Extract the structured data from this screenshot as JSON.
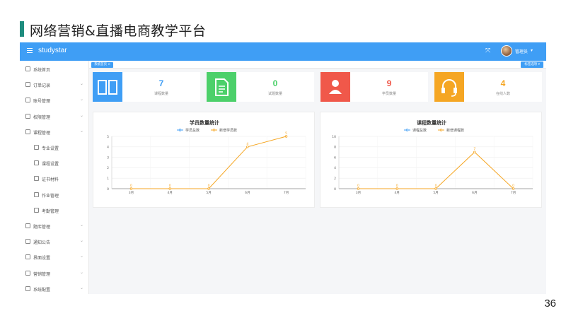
{
  "slide": {
    "title": "网络营销&直播电商教学平台",
    "page_number": "36"
  },
  "colors": {
    "topbar": "#3f9ef5",
    "accent": "#1e8c7e",
    "series_total": "#3f9ef5",
    "series_new": "#f5a623"
  },
  "topbar": {
    "brand": "studystar",
    "fullscreen_icon": "expand-icon",
    "user_name": "管理员",
    "caret": "▾"
  },
  "sidebar": {
    "items": [
      {
        "label": "系统首页",
        "icon": "home-icon",
        "expandable": false,
        "sub": false
      },
      {
        "label": "订单记录",
        "icon": "order-icon",
        "expandable": true,
        "sub": false
      },
      {
        "label": "账号管理",
        "icon": "user-icon",
        "expandable": true,
        "sub": false
      },
      {
        "label": "权限管理",
        "icon": "key-icon",
        "expandable": true,
        "sub": false
      },
      {
        "label": "课程管理",
        "icon": "course-icon",
        "expandable": true,
        "sub": false
      },
      {
        "label": "专业设置",
        "icon": "major-icon",
        "expandable": false,
        "sub": true
      },
      {
        "label": "课程设置",
        "icon": "lesson-icon",
        "expandable": false,
        "sub": true
      },
      {
        "label": "证书材料",
        "icon": "trophy-icon",
        "expandable": false,
        "sub": true
      },
      {
        "label": "作业管理",
        "icon": "homework-icon",
        "expandable": false,
        "sub": true
      },
      {
        "label": "考勤管理",
        "icon": "clock-icon",
        "expandable": false,
        "sub": true
      },
      {
        "label": "题库管理",
        "icon": "bank-icon",
        "expandable": true,
        "sub": false
      },
      {
        "label": "通知公告",
        "icon": "notice-icon",
        "expandable": true,
        "sub": false
      },
      {
        "label": "界面设置",
        "icon": "screen-icon",
        "expandable": true,
        "sub": false
      },
      {
        "label": "营销管理",
        "icon": "marketing-icon",
        "expandable": true,
        "sub": false
      },
      {
        "label": "系统配置",
        "icon": "grid-icon",
        "expandable": true,
        "sub": false
      }
    ]
  },
  "tabs": {
    "active": "系统首页 ×",
    "ops": "标签选项 ▾"
  },
  "stats": [
    {
      "value": "7",
      "label": "课程数量",
      "color": "#3f9ef5",
      "icon": "book-icon"
    },
    {
      "value": "0",
      "label": "试题数量",
      "color": "#4cd06a",
      "icon": "document-icon"
    },
    {
      "value": "9",
      "label": "学员数量",
      "color": "#f0584a",
      "icon": "person-icon"
    },
    {
      "value": "4",
      "label": "在线人数",
      "color": "#f5a623",
      "icon": "headset-icon"
    }
  ],
  "chart_data": [
    {
      "type": "line",
      "title": "学员数量统计",
      "categories": [
        "3月",
        "4月",
        "5月",
        "6月",
        "7月"
      ],
      "ylim": [
        0,
        5
      ],
      "yticks": [
        0,
        1,
        2,
        3,
        4,
        5
      ],
      "grid": true,
      "legend": "top-center",
      "series": [
        {
          "name": "学员总数",
          "values": [
            0,
            0,
            0,
            4,
            5
          ],
          "visible": false
        },
        {
          "name": "新增学员数",
          "values": [
            0,
            0,
            0,
            4,
            5
          ],
          "visible": true
        }
      ]
    },
    {
      "type": "line",
      "title": "课程数量统计",
      "categories": [
        "3月",
        "4月",
        "5月",
        "6月",
        "7月"
      ],
      "ylim": [
        0,
        10
      ],
      "yticks": [
        0,
        2,
        4,
        6,
        8,
        10
      ],
      "grid": true,
      "legend": "top-center",
      "series": [
        {
          "name": "课程总数",
          "values": [
            0,
            0,
            0,
            7,
            0
          ],
          "visible": false
        },
        {
          "name": "新增课程数",
          "values": [
            0,
            0,
            0,
            7,
            0
          ],
          "visible": true
        }
      ]
    }
  ]
}
